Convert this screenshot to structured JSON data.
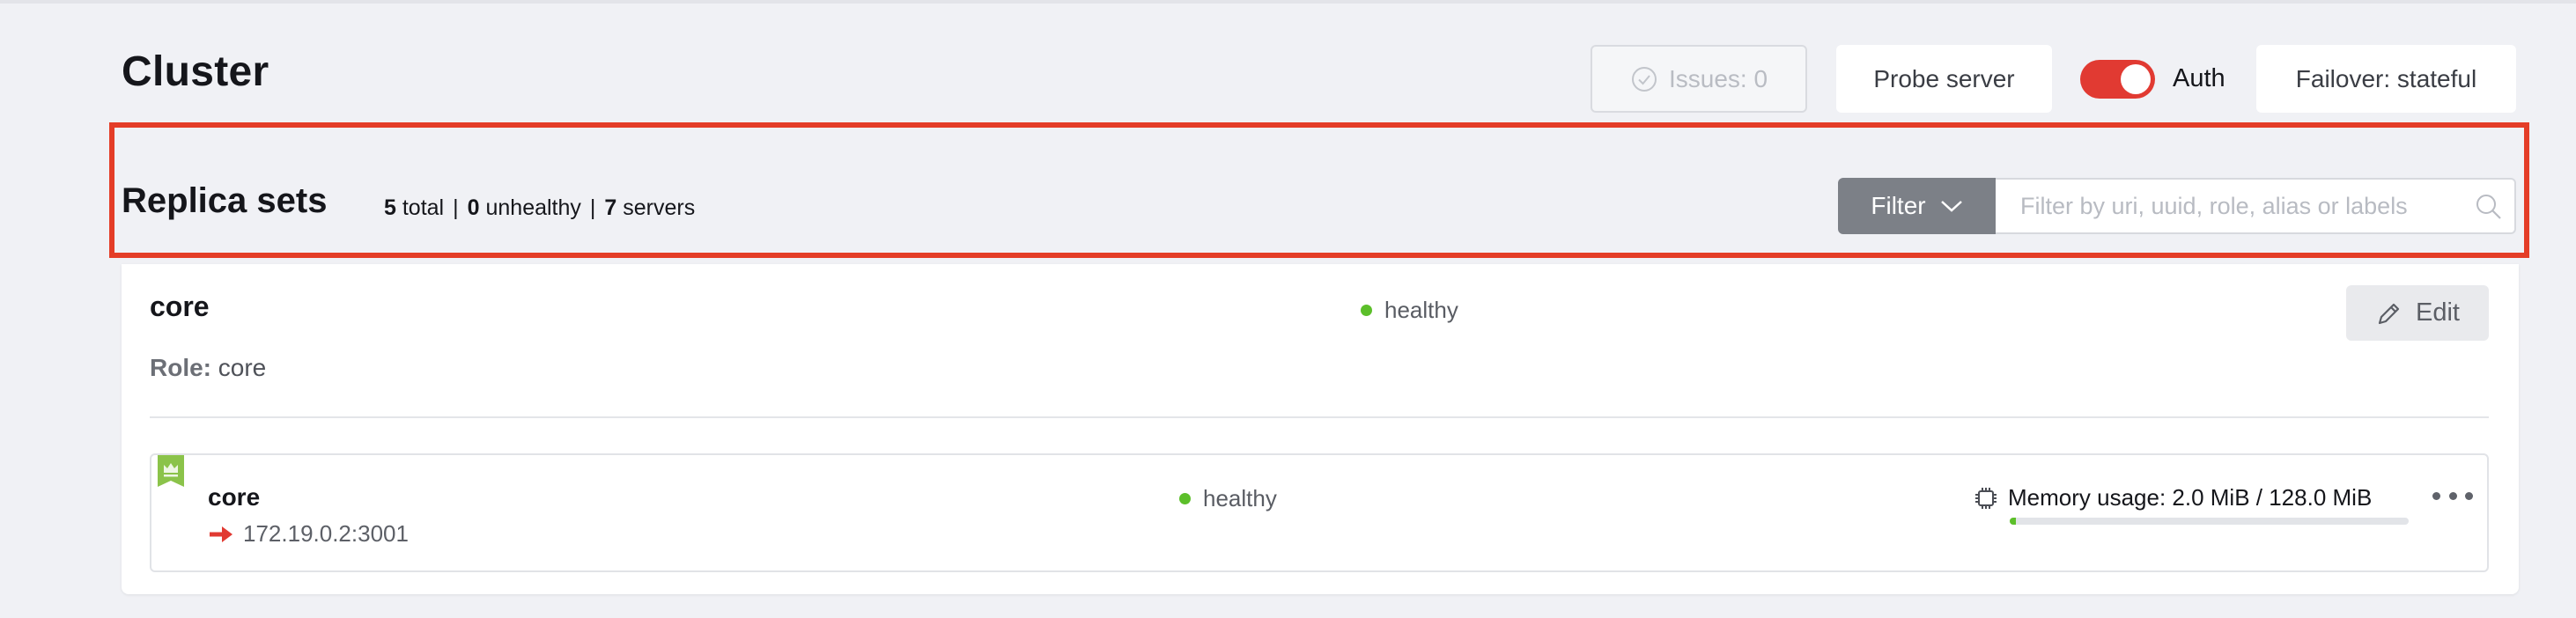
{
  "header": {
    "title": "Cluster",
    "issues_label": "Issues: 0",
    "probe_label": "Probe server",
    "auth_label": "Auth",
    "auth_enabled": true,
    "failover_label": "Failover: stateful"
  },
  "replica_sets": {
    "title": "Replica sets",
    "total_count": "5",
    "total_label": "total",
    "unhealthy_count": "0",
    "unhealthy_label": "unhealthy",
    "servers_count": "7",
    "servers_label": "servers",
    "separator": "|"
  },
  "filter": {
    "button_label": "Filter",
    "placeholder": "Filter by uri, uuid, role, alias or labels",
    "value": ""
  },
  "replica_set_card": {
    "name": "core",
    "status": "healthy",
    "edit_label": "Edit",
    "role_label": "Role:",
    "role_value": "core",
    "server": {
      "name": "core",
      "uri": "172.19.0.2:3001",
      "status": "healthy",
      "memory_text": "Memory usage: 2.0 MiB / 128.0 MiB",
      "memory_fraction": 0.016
    }
  },
  "colors": {
    "accent_red": "#e13a32",
    "healthy_green": "#5cbf2a",
    "leader_badge": "#8bc34a",
    "highlight_border": "#e43d27"
  },
  "icons": {
    "issues": "check-circle-icon",
    "filter": "chevron-down-icon",
    "search": "search-icon",
    "edit": "pencil-icon",
    "leader": "crown-icon",
    "uri": "arrow-right-icon",
    "memory": "chip-icon",
    "menu": "more-horizontal-icon"
  }
}
